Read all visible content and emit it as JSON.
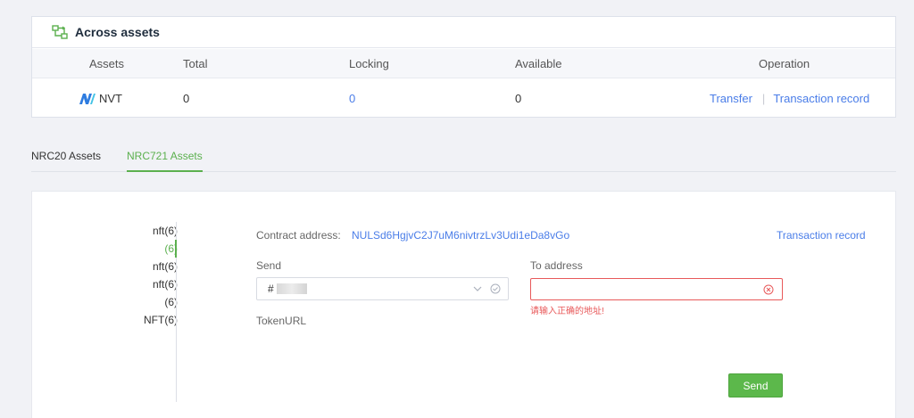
{
  "across_assets": {
    "title": "Across assets",
    "columns": [
      "Assets",
      "Total",
      "Locking",
      "Available",
      "Operation"
    ],
    "row": {
      "asset": "NVT",
      "total": "0",
      "locking": "0",
      "available": "0",
      "ops": [
        "Transfer",
        "|",
        "Transaction record"
      ]
    }
  },
  "tabs": [
    "NRC20 Assets",
    "NRC721 Assets"
  ],
  "active_tab": "NRC721 Assets",
  "nft_list": [
    "nft(6)",
    "(6)",
    "nft(6)",
    "nft(6)",
    "(6)",
    "NFT(6)"
  ],
  "active_nft_index": 1,
  "form": {
    "contract_label": "Contract address:",
    "contract_address": "NULSd6HgjvC2J7uM6nivtrzLv3Udi1eDa8vGo",
    "transaction_record": "Transaction record",
    "send_label": "Send",
    "send_value_prefix": "#",
    "to_label": "To address",
    "to_error": "请输入正确的地址!",
    "token_url_label": "TokenURL",
    "send_button": "Send"
  },
  "colors": {
    "accent_green": "#5bb04e",
    "link_blue": "#4a7de8",
    "error_red": "#e8595a"
  },
  "icons": {
    "across_assets": "cross-chain-icon",
    "nvt": "nuls-logo-icon",
    "dropdown": "chevron-down-icon",
    "valid": "check-circle-icon",
    "error": "error-circle-icon"
  }
}
